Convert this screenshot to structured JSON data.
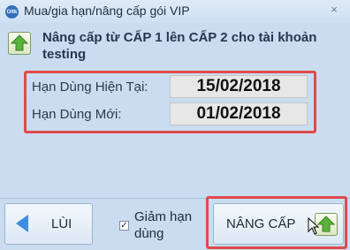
{
  "window": {
    "title": "Mua/gia hạn/nâng cấp gói VIP",
    "app_icon_text": "Oltk",
    "close_glyph": "×"
  },
  "headline": "Nâng cấp từ CẤP 1 lên CẤP 2 cho tài khoản testing",
  "fields": {
    "current_label": "Hạn Dùng Hiện Tại:",
    "current_value": "15/02/2018",
    "new_label": "Hạn Dùng Mới:",
    "new_value": "01/02/2018"
  },
  "footer": {
    "back_label": "LÙI",
    "checkbox_label": "Giảm hạn dùng",
    "checkbox_checked": "✓",
    "upgrade_label": "NÂNG CẤP"
  },
  "colors": {
    "highlight": "#e04a4a",
    "accent_blue": "#3f8fe0",
    "upgrade_green": "#59b23a"
  }
}
